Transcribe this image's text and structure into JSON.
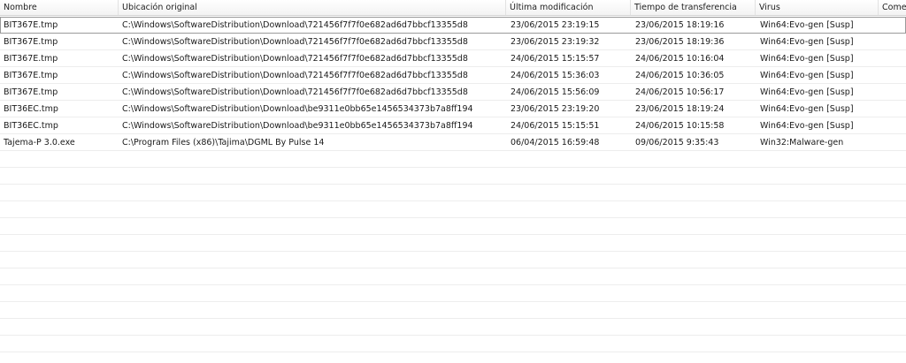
{
  "columns": [
    "Nombre",
    "Ubicación original",
    "Última modificación",
    "Tiempo de transferencia",
    "Virus",
    "Come"
  ],
  "rows": [
    [
      "BIT367E.tmp",
      "C:\\Windows\\SoftwareDistribution\\Download\\721456f7f7f0e682ad6d7bbcf13355d8",
      "23/06/2015 23:19:15",
      "23/06/2015 18:19:16",
      "Win64:Evo-gen [Susp]"
    ],
    [
      "BIT367E.tmp",
      "C:\\Windows\\SoftwareDistribution\\Download\\721456f7f7f0e682ad6d7bbcf13355d8",
      "23/06/2015 23:19:32",
      "23/06/2015 18:19:36",
      "Win64:Evo-gen [Susp]"
    ],
    [
      "BIT367E.tmp",
      "C:\\Windows\\SoftwareDistribution\\Download\\721456f7f7f0e682ad6d7bbcf13355d8",
      "24/06/2015 15:15:57",
      "24/06/2015 10:16:04",
      "Win64:Evo-gen [Susp]"
    ],
    [
      "BIT367E.tmp",
      "C:\\Windows\\SoftwareDistribution\\Download\\721456f7f7f0e682ad6d7bbcf13355d8",
      "24/06/2015 15:36:03",
      "24/06/2015 10:36:05",
      "Win64:Evo-gen [Susp]"
    ],
    [
      "BIT367E.tmp",
      "C:\\Windows\\SoftwareDistribution\\Download\\721456f7f7f0e682ad6d7bbcf13355d8",
      "24/06/2015 15:56:09",
      "24/06/2015 10:56:17",
      "Win64:Evo-gen [Susp]"
    ],
    [
      "BIT36EC.tmp",
      "C:\\Windows\\SoftwareDistribution\\Download\\be9311e0bb65e1456534373b7a8ff194",
      "23/06/2015 23:19:20",
      "23/06/2015 18:19:24",
      "Win64:Evo-gen [Susp]"
    ],
    [
      "BIT36EC.tmp",
      "C:\\Windows\\SoftwareDistribution\\Download\\be9311e0bb65e1456534373b7a8ff194",
      "24/06/2015 15:15:51",
      "24/06/2015 10:15:58",
      "Win64:Evo-gen [Susp]"
    ],
    [
      "Tajema-P 3.0.exe",
      "C:\\Program Files (x86)\\Tajima\\DGML By Pulse 14",
      "06/04/2015 16:59:48",
      "09/06/2015 9:35:43",
      "Win32:Malware-gen"
    ]
  ]
}
